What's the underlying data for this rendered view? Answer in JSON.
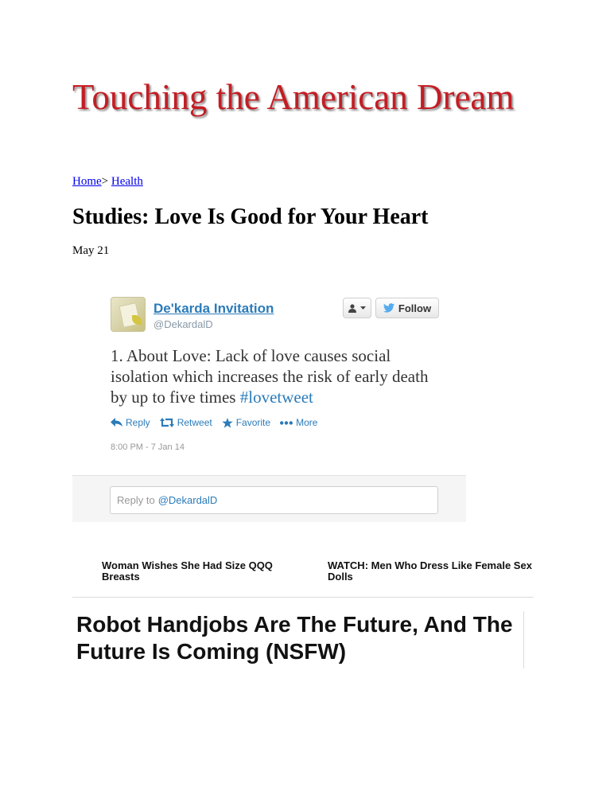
{
  "site": {
    "title": "Touching the American Dream"
  },
  "breadcrumb": {
    "home": "Home",
    "separator": ">",
    "section": "Health"
  },
  "article": {
    "title": "Studies: Love Is Good for Your Heart",
    "date": "May 21"
  },
  "tweet": {
    "author_name": "De'karda Invitation",
    "author_handle": "@DekardalD",
    "follow_label": "Follow",
    "text": "1. About Love: Lack of love causes social isolation which increases the risk of early death by up to five times",
    "hashtag": "#lovetweet",
    "actions": {
      "reply": "Reply",
      "retweet": "Retweet",
      "favorite": "Favorite",
      "more": "More"
    },
    "timestamp": "8:00 PM - 7 Jan 14",
    "reply_prefix": "Reply to",
    "reply_mention": "@DekardalD",
    "colors": {
      "link": "#2b7bb9",
      "muted": "#8899a6"
    }
  },
  "related": {
    "left": "Woman Wishes She Had Size QQQ Breasts",
    "right": "WATCH: Men Who Dress Like Female Sex Dolls"
  },
  "feature": {
    "headline": "Robot Handjobs Are The Future, And The Future Is Coming (NSFW)"
  },
  "colors": {
    "site_title": "#c41d24",
    "link": "#0000ee"
  }
}
